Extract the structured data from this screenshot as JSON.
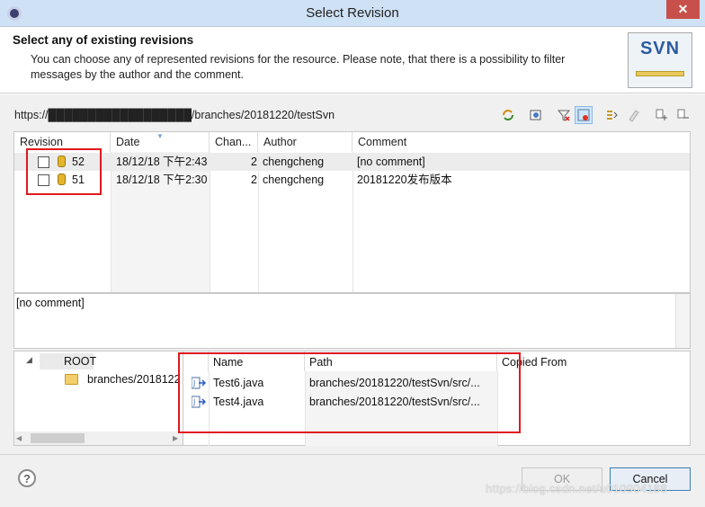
{
  "window": {
    "title": "Select Revision",
    "close_glyph": "✕"
  },
  "header": {
    "title": "Select any of existing revisions",
    "description": "You can choose any of represented revisions for the resource. Please note, that there is a possibility to filter messages by the author and the comment.",
    "logo_text": "SVN"
  },
  "resource_url": "https://██████████████████/branches/20181220/testSvn",
  "toolbar_icons": [
    "refresh-icon",
    "compare-icon",
    "filter-icon",
    "hide-unrelated-icon",
    "stop-on-copy-icon",
    "clear-filter-icon",
    "expand-icon",
    "collapse-icon"
  ],
  "revisions": {
    "columns": [
      "Revision",
      "Date",
      "Chan...",
      "Author",
      "Comment"
    ],
    "rows": [
      {
        "revision": "52",
        "date": "18/12/18 下午2:43",
        "changes": "2",
        "author": "chengcheng",
        "comment": "[no comment]"
      },
      {
        "revision": "51",
        "date": "18/12/18 下午2:30",
        "changes": "2",
        "author": "chengcheng",
        "comment": "20181220发布版本"
      }
    ]
  },
  "comment_text": "[no comment]",
  "tree": {
    "root": "ROOT",
    "child": "branches/2018122",
    "expand_glyph": "◢"
  },
  "changed_paths": {
    "columns": [
      "Name",
      "Path",
      "Copied From"
    ],
    "rows": [
      {
        "name": "Test6.java",
        "path": "branches/20181220/testSvn/src/..."
      },
      {
        "name": "Test4.java",
        "path": "branches/20181220/testSvn/src/..."
      }
    ]
  },
  "footer": {
    "help_glyph": "?",
    "ok_label": "OK",
    "cancel_label": "Cancel"
  },
  "watermark": "https://blog.csdn.net/u010904188"
}
